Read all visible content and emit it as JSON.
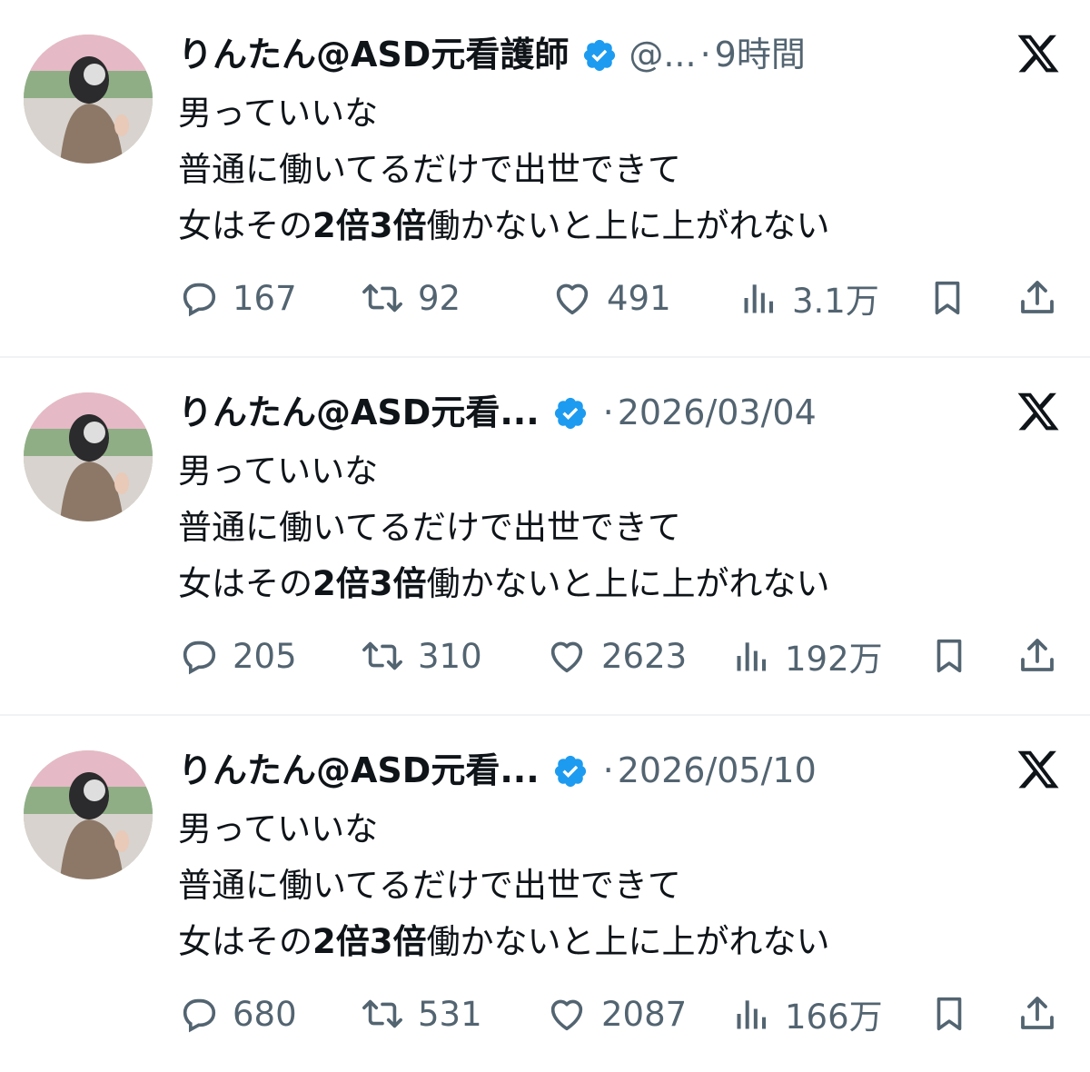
{
  "tweets": [
    {
      "display_name": "りんたん@ASD元看護師",
      "handle": "@...",
      "separator": "·",
      "time": "9時間",
      "text_line1": "男っていいな",
      "text_line2": "普通に働いてるだけで出世できて",
      "text_line3_a": "女はその",
      "text_line3_bold": "2倍3倍",
      "text_line3_b": "働かないと上に上がれない",
      "replies": "167",
      "retweets": "92",
      "likes": "491",
      "views": "3.1万"
    },
    {
      "display_name": "りんたん@ASD元看...",
      "handle": "",
      "separator": "·",
      "time": "2026/03/04",
      "text_line1": "男っていいな",
      "text_line2": "普通に働いてるだけで出世できて",
      "text_line3_a": "女はその",
      "text_line3_bold": "2倍3倍",
      "text_line3_b": "働かないと上に上がれない",
      "replies": "205",
      "retweets": "310",
      "likes": "2623",
      "views": "192万"
    },
    {
      "display_name": "りんたん@ASD元看...",
      "handle": "",
      "separator": "·",
      "time": "2026/05/10",
      "text_line1": "男っていいな",
      "text_line2": "普通に働いてるだけで出世できて",
      "text_line3_a": "女はその",
      "text_line3_bold": "2倍3倍",
      "text_line3_b": "働かないと上に上がれない",
      "replies": "680",
      "retweets": "531",
      "likes": "2087",
      "views": "166万"
    }
  ],
  "colors": {
    "text": "#0f1419",
    "secondary": "#536471",
    "verified": "#1d9bf0",
    "divider": "#eff3f4"
  },
  "icons": {
    "reply": "speech-bubble-icon",
    "retweet": "retweet-icon",
    "like": "heart-icon",
    "views": "bar-chart-icon",
    "bookmark": "bookmark-icon",
    "share": "share-upload-icon",
    "brand": "x-logo-icon",
    "verified": "verified-badge-icon"
  }
}
